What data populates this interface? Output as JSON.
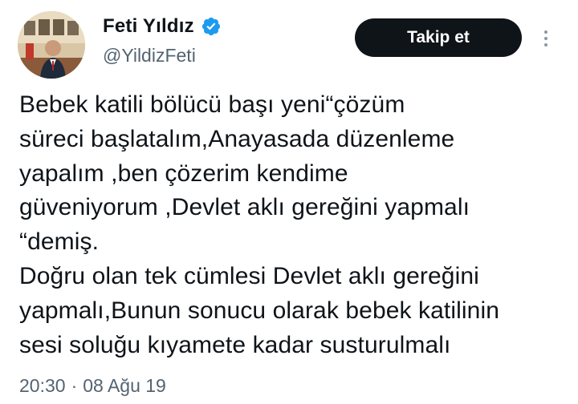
{
  "author": {
    "display_name": "Feti Yıldız",
    "handle": "@YildizFeti",
    "verified_icon": "verified-badge-icon",
    "verified_color": "#1d9bf0"
  },
  "actions": {
    "follow_label": "Takip et",
    "more_icon": "more-vertical-icon"
  },
  "tweet": {
    "lines": [
      "Bebek katili bölücü başı yeni“çözüm",
      "süreci başlatalım,Anayasada düzenleme",
      "yapalım ,ben çözerim kendime",
      "güveniyorum ,Devlet aklı gereğini yapmalı",
      "“demiş.",
      "Doğru olan tek cümlesi Devlet aklı gereğini",
      "yapmalı,Bunun sonucu olarak bebek katilinin",
      "sesi soluğu kıyamete kadar susturulmalı"
    ]
  },
  "meta": {
    "time": "20:30",
    "separator": "·",
    "date": "08 Ağu 19"
  },
  "colors": {
    "text": "#0f1419",
    "secondary": "#536471",
    "button_bg": "#0f1419",
    "button_text": "#ffffff"
  }
}
